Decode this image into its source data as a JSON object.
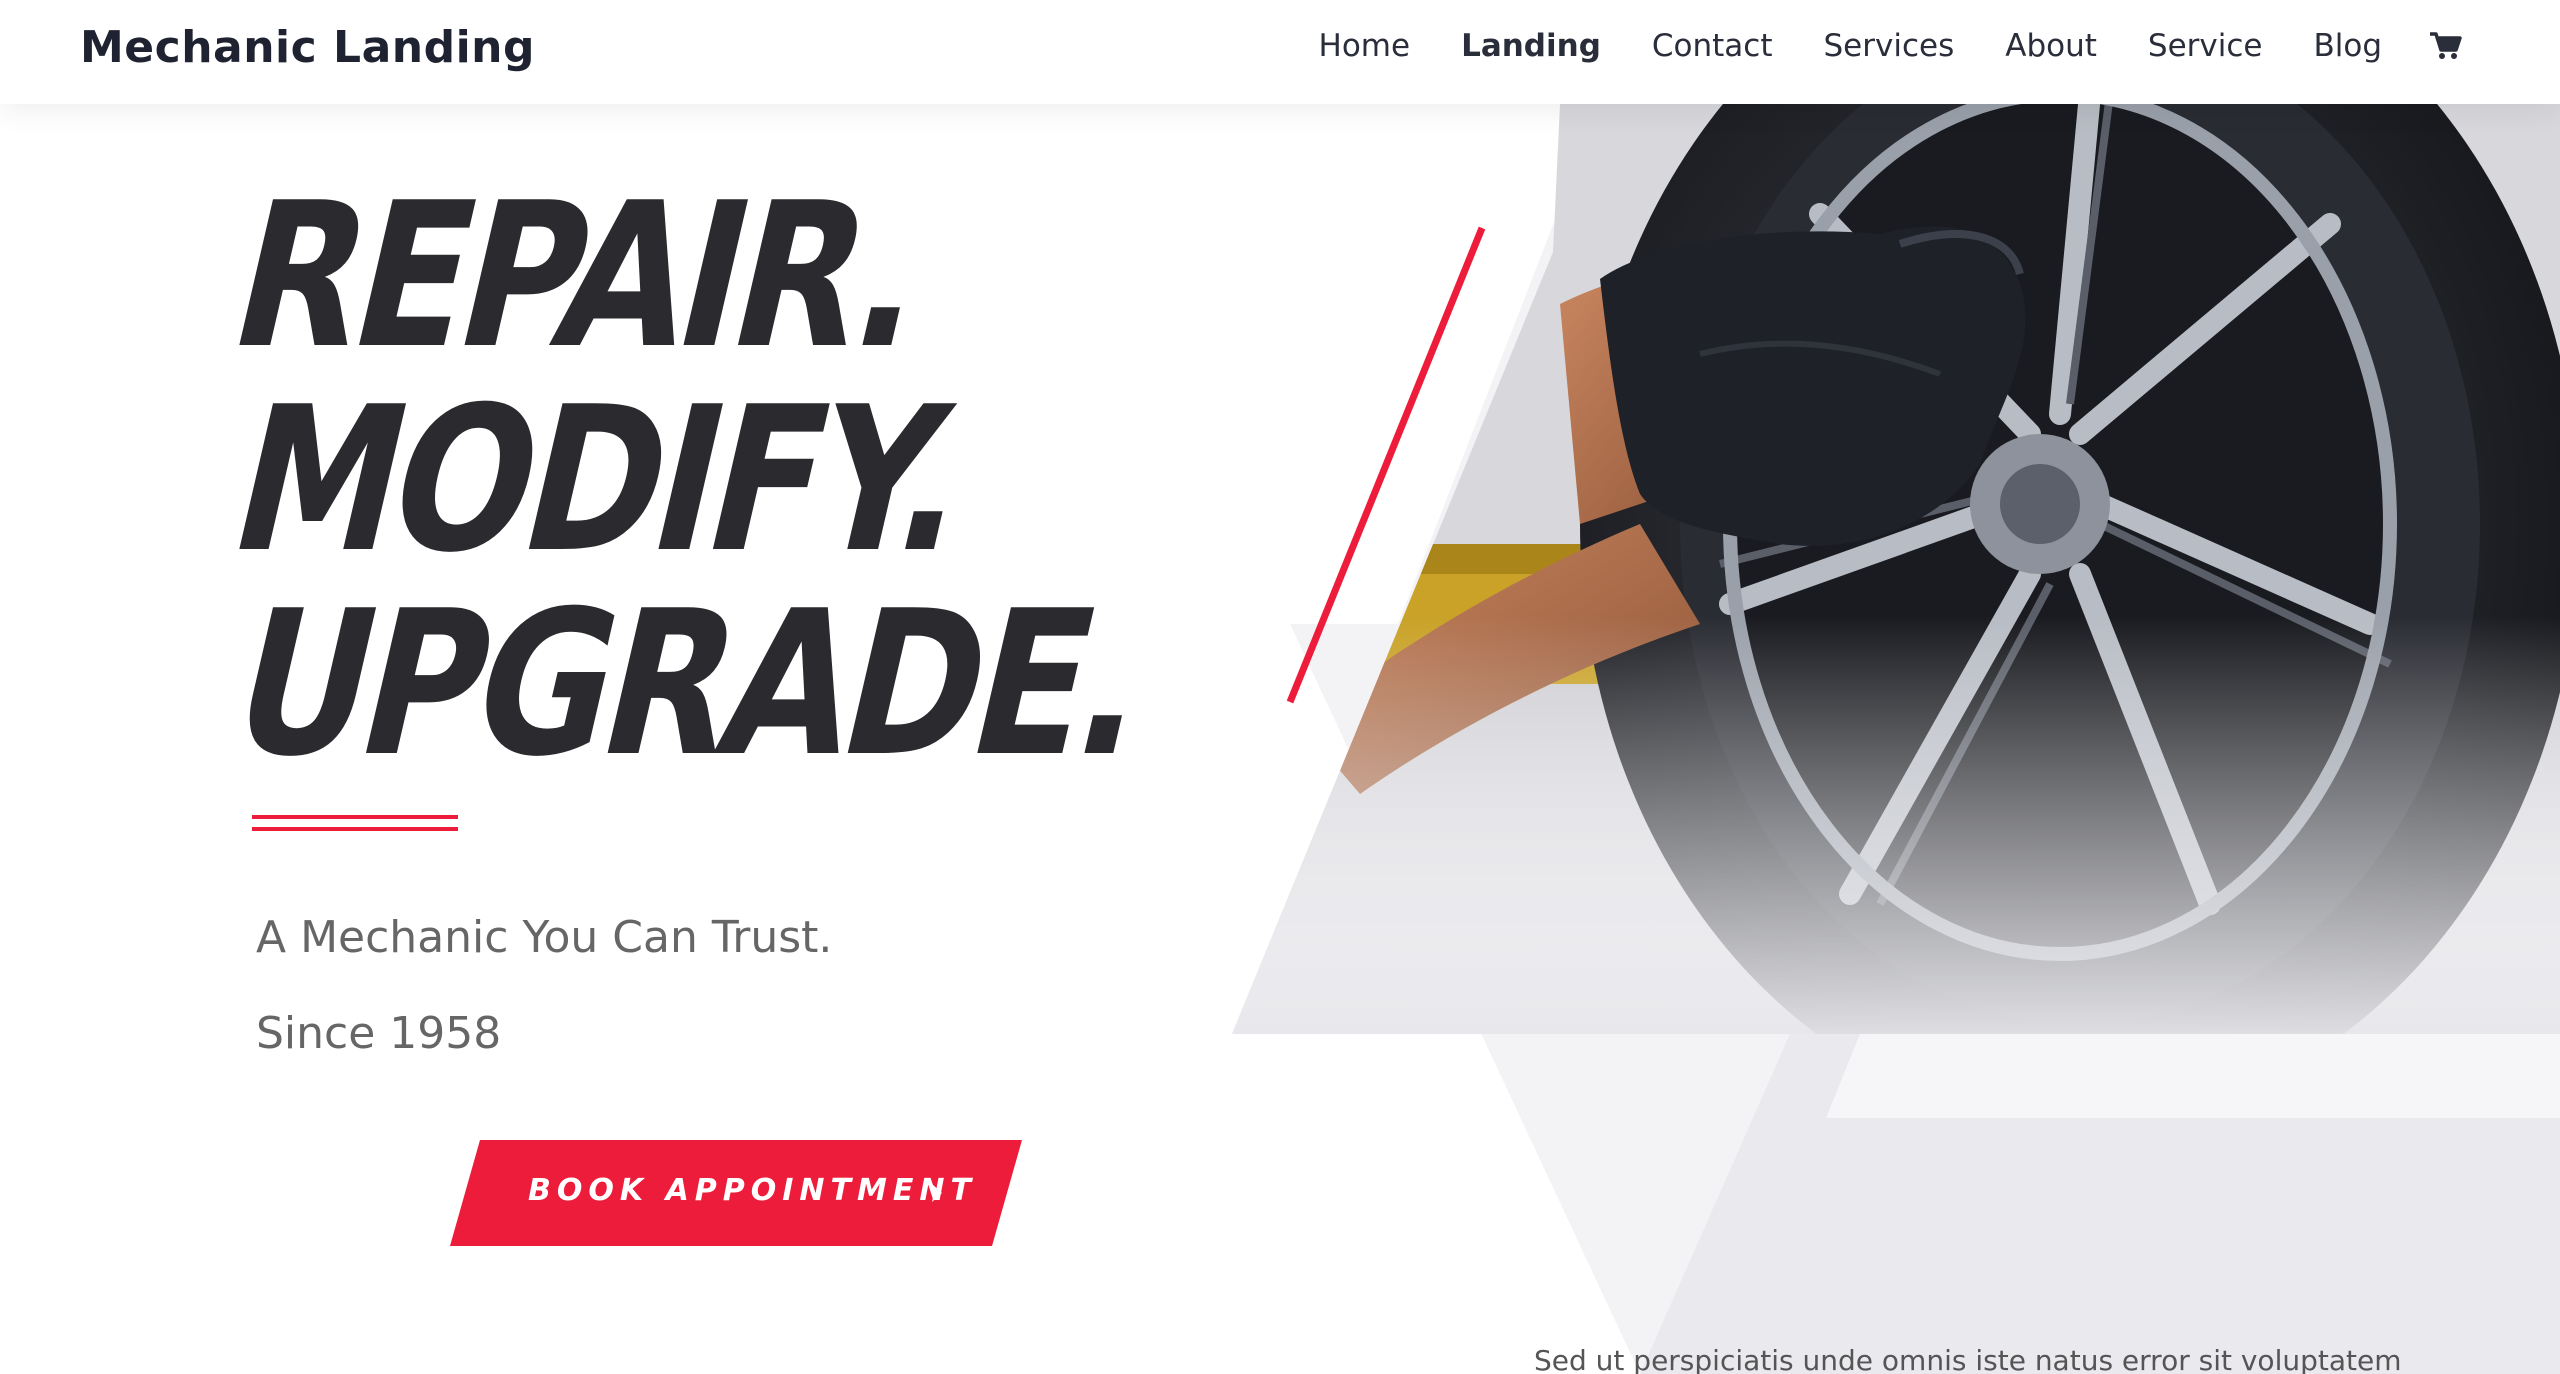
{
  "header": {
    "logo": "Mechanic Landing",
    "nav": [
      "Home",
      "Landing",
      "Contact",
      "Services",
      "About",
      "Service",
      "Blog"
    ],
    "active_nav": "Landing",
    "cart_icon": "cart-icon"
  },
  "hero": {
    "headline": [
      "REPAIR.",
      "MODIFY.",
      "UPGRADE."
    ],
    "tagline_1": "A Mechanic You Can Trust.",
    "tagline_2": "Since 1958",
    "cta_label": "BOOK APPOINTMENT",
    "cta_icon": "caret-right-icon",
    "image_subject": "gloved hand tightening wheel lug on alloy rim"
  },
  "body": {
    "intro": "Sed ut perspiciatis unde omnis iste natus error sit voluptatem"
  },
  "colors": {
    "accent": "#ee1c3b",
    "heading": "#2b2b2f",
    "text_muted": "#666666",
    "nav_text": "#2a2d3a"
  }
}
